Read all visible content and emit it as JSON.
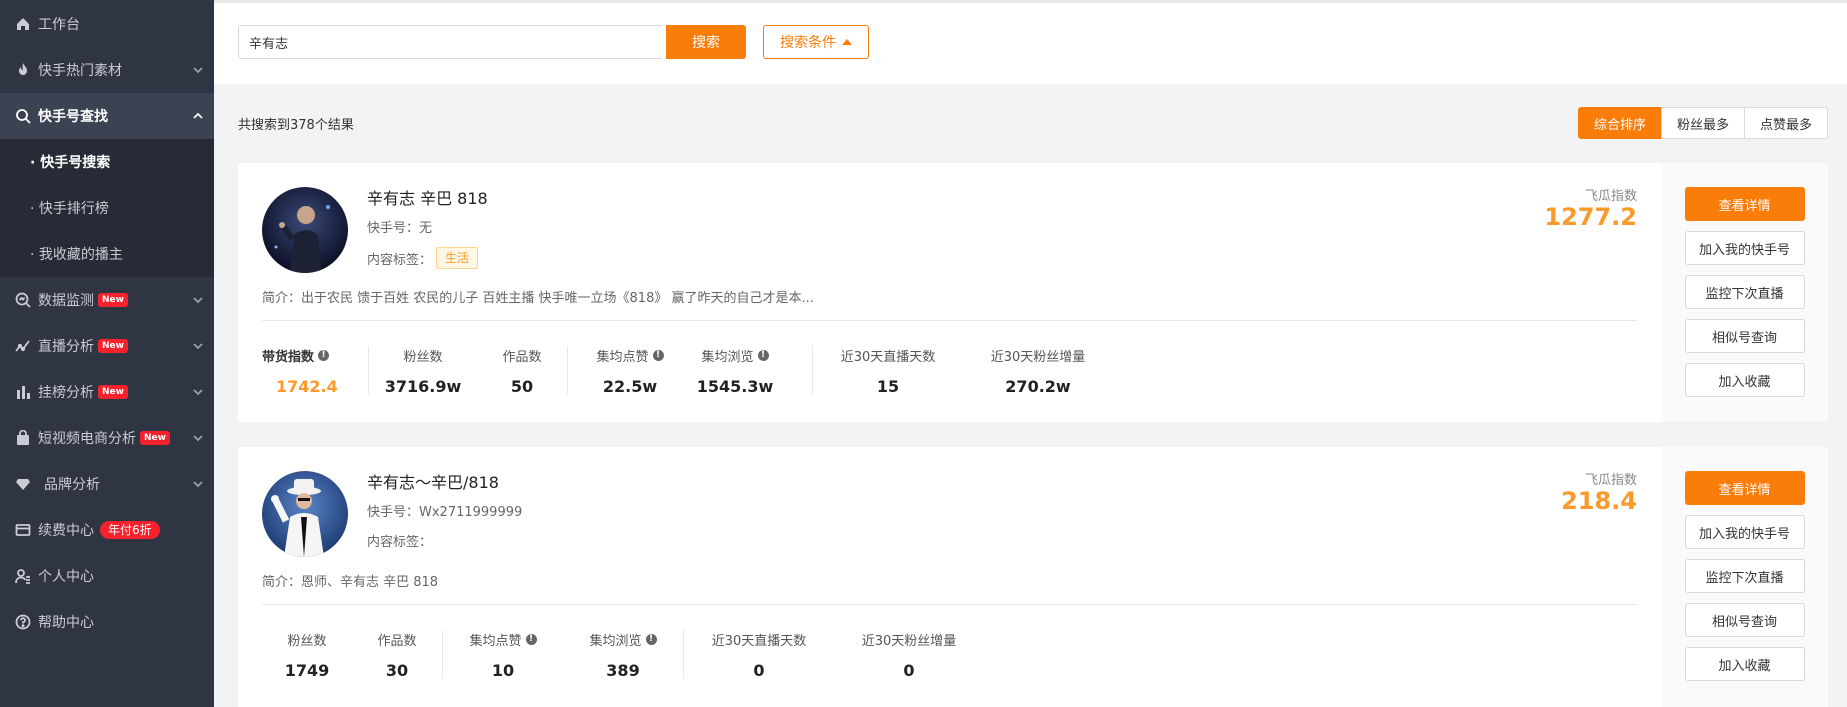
{
  "sidebar": {
    "items": [
      {
        "label": "工作台"
      },
      {
        "label": "快手热门素材"
      },
      {
        "label": "快手号查找"
      },
      {
        "label": "数据监测",
        "badge": "New"
      },
      {
        "label": "直播分析",
        "badge": "New"
      },
      {
        "label": "挂榜分析",
        "badge": "New"
      },
      {
        "label": "短视频电商分析",
        "badge": "New"
      },
      {
        "label": "品牌分析"
      },
      {
        "label": "续费中心",
        "promo": "年付6折"
      },
      {
        "label": "个人中心"
      },
      {
        "label": "帮助中心"
      }
    ],
    "subitems": [
      {
        "label": "· 快手号搜索"
      },
      {
        "label": "· 快手排行榜"
      },
      {
        "label": "· 我收藏的播主"
      }
    ]
  },
  "search": {
    "value": "辛有志",
    "button": "搜索",
    "conditions": "搜索条件"
  },
  "results": {
    "count_text": "共搜索到378个结果",
    "sort": [
      "综合排序",
      "粉丝最多",
      "点赞最多"
    ]
  },
  "actions": [
    "查看详情",
    "加入我的快手号",
    "监控下次直播",
    "相似号查询",
    "加入收藏"
  ],
  "cards": [
    {
      "name": "辛有志 辛巴 818",
      "ksid": "快手号：无",
      "tags_label": "内容标签：",
      "tag": "生活",
      "intro": "简介：出于农民 馈于百姓 农民的儿子 百姓主播 快手唯一立场《818》 赢了昨天的自己才是本...",
      "flg_label": "飞瓜指数",
      "flg_value": "1277.2",
      "stats": [
        {
          "label": "带货指数",
          "value": "1742.4"
        },
        {
          "label": "粉丝数",
          "value": "3716.9w"
        },
        {
          "label": "作品数",
          "value": "50"
        },
        {
          "label": "集均点赞",
          "value": "22.5w"
        },
        {
          "label": "集均浏览",
          "value": "1545.3w"
        },
        {
          "label": "近30天直播天数",
          "value": "15"
        },
        {
          "label": "近30天粉丝增量",
          "value": "270.2w"
        }
      ]
    },
    {
      "name": "辛有志～辛巴/818",
      "ksid": "快手号：Wx2711999999",
      "tags_label": "内容标签：",
      "intro": "简介：恩师、辛有志 辛巴 818",
      "flg_label": "飞瓜指数",
      "flg_value": "218.4",
      "stats": [
        {
          "label": "粉丝数",
          "value": "1749"
        },
        {
          "label": "作品数",
          "value": "30"
        },
        {
          "label": "集均点赞",
          "value": "10"
        },
        {
          "label": "集均浏览",
          "value": "389"
        },
        {
          "label": "近30天直播天数",
          "value": "0"
        },
        {
          "label": "近30天粉丝增量",
          "value": "0"
        }
      ]
    }
  ]
}
